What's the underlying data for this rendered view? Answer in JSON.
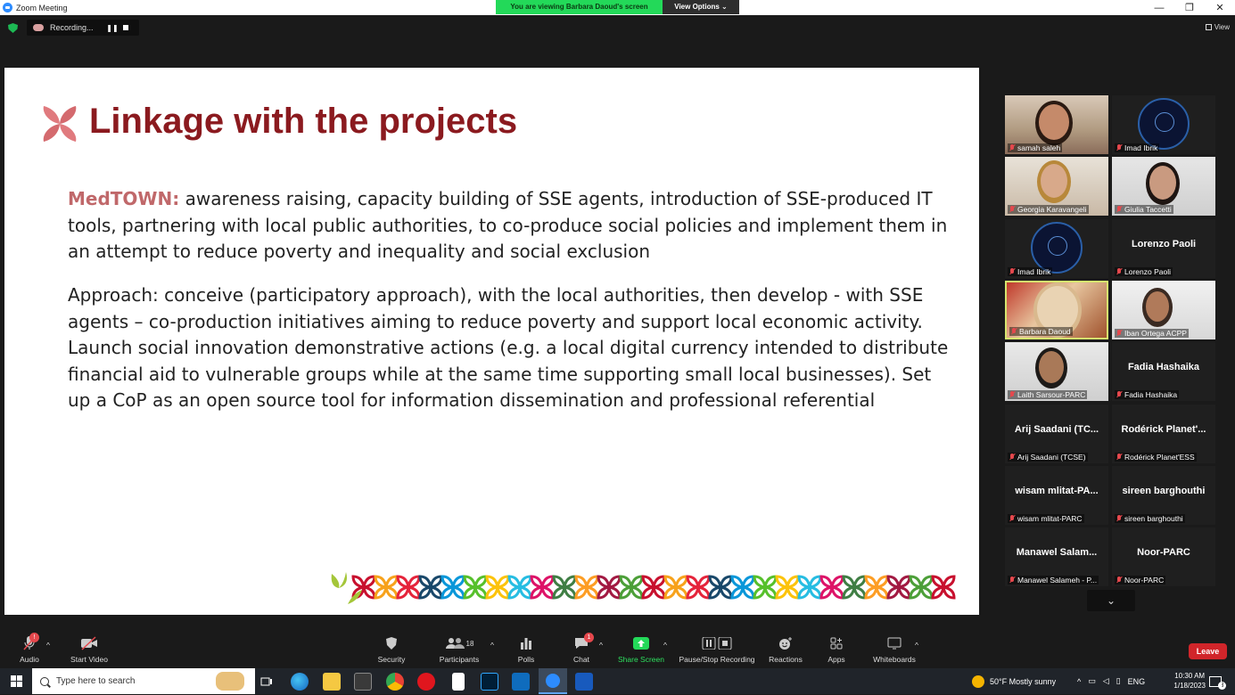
{
  "window": {
    "title": "Zoom Meeting",
    "controls": [
      "—",
      "❐",
      "✕"
    ]
  },
  "banner": {
    "viewing": "You are viewing Barbara Daoud's screen",
    "view_options": "View Options ⌄"
  },
  "recording": {
    "label": "Recording...",
    "pause": "❚❚"
  },
  "view_button": "View",
  "slide": {
    "title": "Linkage with the projects",
    "para1_highlight": "MedTOWN:",
    "para1_text": " awareness raising, capacity building of SSE agents, introduction of SSE-produced IT tools, partnering with local public authorities, to co-produce social policies and implement them in an attempt to reduce poverty and inequality and social exclusion",
    "para2_text": "Approach: conceive (participatory approach), with the local authorities, then develop - with SSE agents – co-production initiatives aiming to reduce poverty and support local economic activity. Launch social innovation demonstrative actions (e.g. a local digital currency intended to distribute financial aid to vulnerable groups while at the same time supporting small local businesses). Set up a CoP as an open source tool for information dissemination and professional referential",
    "pattern_colors": [
      "#c8102e",
      "#f7a21b",
      "#e5243b",
      "#19486a",
      "#0a97d9",
      "#56c02b",
      "#fcc30b",
      "#26bde2",
      "#dd1367",
      "#3f7e44",
      "#fd9d24",
      "#a21942",
      "#4c9f38"
    ]
  },
  "participants": [
    {
      "name": "samah saleh",
      "display": "",
      "type": "photo"
    },
    {
      "name": "Imad Ibrik",
      "display": "",
      "type": "logo"
    },
    {
      "name": "Georgia Karavangeli",
      "display": "",
      "type": "photo"
    },
    {
      "name": "Giulia Taccetti",
      "display": "",
      "type": "photo"
    },
    {
      "name": "Imad Ibrik",
      "display": "",
      "type": "logo"
    },
    {
      "name": "Lorenzo Paoli",
      "display": "Lorenzo Paoli",
      "type": "name"
    },
    {
      "name": "Barbara Daoud",
      "display": "",
      "type": "photo",
      "active": true
    },
    {
      "name": "Iban Ortega ACPP",
      "display": "",
      "type": "photo"
    },
    {
      "name": "Laith Sarsour-PARC",
      "display": "",
      "type": "photo"
    },
    {
      "name": "Fadia Hashaika",
      "display": "Fadia Hashaika",
      "type": "name"
    },
    {
      "name": "Arij Saadani (TCSE)",
      "display": "Arij Saadani (TC...",
      "type": "name"
    },
    {
      "name": "Rodérick Planet'ESS",
      "display": "Rodérick Planet'...",
      "type": "name"
    },
    {
      "name": "wisam mlitat-PARC",
      "display": "wisam mlitat-PA...",
      "type": "name"
    },
    {
      "name": "sireen barghouthi",
      "display": "sireen barghouthi",
      "type": "name"
    },
    {
      "name": "Manawel Salameh - P...",
      "display": "Manawel Salam...",
      "type": "name"
    },
    {
      "name": "Noor-PARC",
      "display": "Noor-PARC",
      "type": "name"
    }
  ],
  "gallery_arrow": "⌄",
  "toolbar": {
    "audio": "Audio",
    "audio_badge": "!",
    "start_video": "Start Video",
    "security": "Security",
    "participants": "Participants",
    "participants_count": "18",
    "polls": "Polls",
    "chat": "Chat",
    "chat_badge": "1",
    "share_screen": "Share Screen",
    "recording": "Pause/Stop Recording",
    "reactions": "Reactions",
    "apps": "Apps",
    "whiteboards": "Whiteboards",
    "leave": "Leave"
  },
  "taskbar": {
    "search_placeholder": "Type here to search",
    "weather": "50°F  Mostly sunny",
    "language": "ENG",
    "time": "10:30 AM",
    "date": "1/18/2023",
    "notifications": "3"
  },
  "colors": {
    "accent_green": "#23d959",
    "leave_red": "#d1252a",
    "title_red": "#8b1a1f",
    "highlight": "#c0686a"
  }
}
